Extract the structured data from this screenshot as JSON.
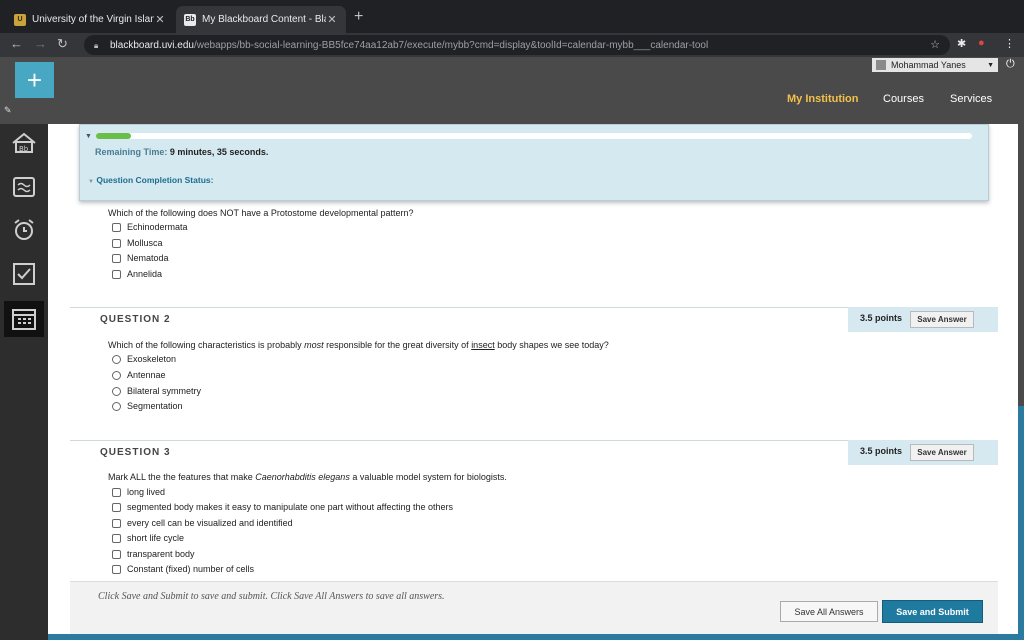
{
  "browser": {
    "tabs": [
      {
        "title": "University of the Virgin Islands",
        "favicon": "uvi-seal-icon"
      },
      {
        "title": "My Blackboard Content - Blac",
        "favicon": "bb-icon"
      }
    ],
    "url_host": "blackboard.uvi.edu",
    "url_path": "/webapps/bb-social-learning-BB5fce74aa12ab7/execute/mybb?cmd=display&toolId=calendar-mybb___calendar-tool"
  },
  "header": {
    "user_name": "Mohammad Yanes",
    "nav": [
      "My Institution",
      "Courses",
      "Services"
    ]
  },
  "timer": {
    "progress": 0.04,
    "remaining_label": "Remaining Time:",
    "remaining_value": "9 minutes, 35 seconds.",
    "status_label": "Question Completion Status:"
  },
  "question1": {
    "text": "Which of the following does NOT have a Protostome developmental pattern?",
    "options": [
      "Echinodermata",
      "Mollusca",
      "Nematoda",
      "Annelida"
    ]
  },
  "question2": {
    "title": "QUESTION 2",
    "points": "3.5 points",
    "save": "Save Answer",
    "text_a": "Which of the following characteristics is probably ",
    "text_b": "most",
    "text_c": " responsible for the great diversity of ",
    "text_d": "insect",
    "text_e": " body shapes we see today?",
    "options": [
      "Exoskeleton",
      "Antennae",
      "Bilateral symmetry",
      "Segmentation"
    ]
  },
  "question3": {
    "title": "QUESTION 3",
    "points": "3.5 points",
    "save": "Save Answer",
    "text_a": "Mark ALL the the features that make ",
    "text_b": "Caenorhabditis elegans",
    "text_c": " a valuable model system for biologists.",
    "options": [
      "long lived",
      "segmented body makes it easy to manipulate one part without affecting the others",
      "every cell can be visualized and identified",
      "short life cycle",
      "transparent body",
      "Constant (fixed) number of cells"
    ]
  },
  "footer": {
    "hint": "Click Save and Submit to save and submit. Click Save All Answers to save all answers.",
    "save_all": "Save All Answers",
    "submit": "Save and Submit"
  },
  "colors": {
    "accent": "#1f7aa0",
    "nav_active": "#f3c14b",
    "progress": "#6abf4b"
  }
}
